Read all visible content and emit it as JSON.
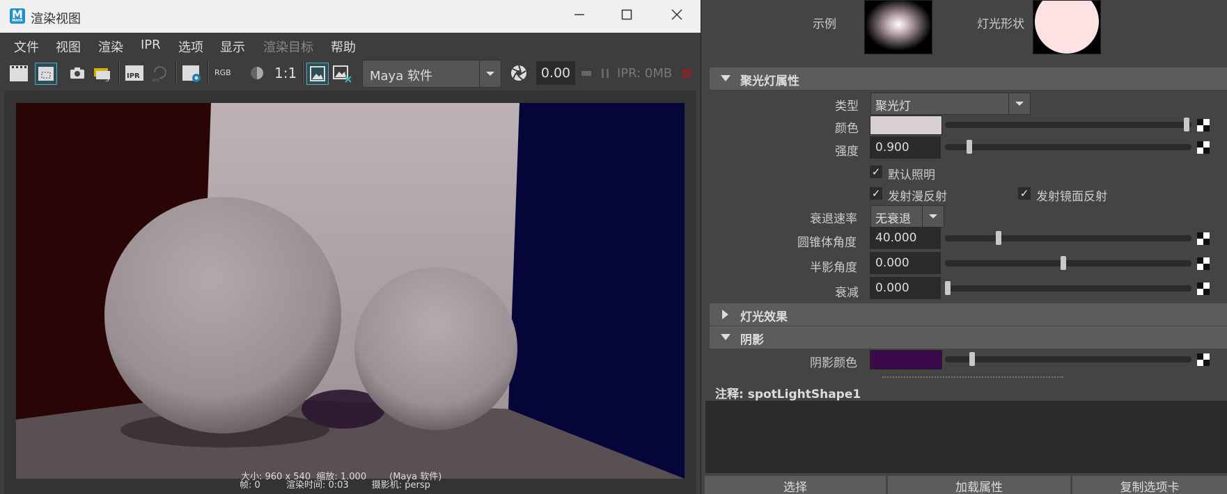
{
  "window": {
    "title": "渲染视图",
    "app_icon_letter": "M",
    "app_icon_sub": "MAYA"
  },
  "menu": [
    "文件",
    "视图",
    "渲染",
    "IPR",
    "选项",
    "显示",
    "渲染目标",
    "帮助"
  ],
  "menu_disabled_index": 6,
  "toolbar": {
    "ratio_label": "1:1",
    "rgb_label": "RGB",
    "ipr_label": "IPR",
    "renderer": "Maya 软件",
    "exposure": "0.00",
    "ipr_memory": "IPR: 0MB"
  },
  "render_info": {
    "line1": "大小: 960 x 540  缩放: 1.000        (Maya 软件)",
    "line2": "帧: 0         渲染时间: 0:03        摄影机: persp"
  },
  "attr": {
    "example_label": "示例",
    "light_shape_label": "灯光形状",
    "spotlight_section": "聚光灯属性",
    "type_label": "类型",
    "type_value": "聚光灯",
    "color_label": "颜色",
    "intensity_label": "强度",
    "intensity_value": "0.900",
    "default_lighting": "默认照明",
    "emit_diffuse": "发射漫反射",
    "emit_specular": "发射镜面反射",
    "decay_rate_label": "衰退速率",
    "decay_rate_value": "无衰退",
    "cone_angle_label": "圆锥体角度",
    "cone_angle_value": "40.000",
    "penumbra_label": "半影角度",
    "penumbra_value": "0.000",
    "dropoff_label": "衰减",
    "dropoff_value": "0.000",
    "light_effects_section": "灯光效果",
    "shadows_section": "阴影",
    "shadow_color_label": "阴影颜色",
    "notes_label": "注释:  spotLightShape1",
    "select_button": "选择",
    "load_attributes_button": "加载属性",
    "copy_tab_button": "复制选项卡"
  },
  "colors": {
    "light_color": "#d8cfd0",
    "shadow_color": "#3a0a4a",
    "render_floor": "#5a5054",
    "render_left_wall": "#2a0505",
    "render_back_wall": "#b9aeb1",
    "render_right_wall": "#05053a"
  },
  "sliders": {
    "color_level": 0.99,
    "intensity_level": 0.09,
    "cone_angle_level": 0.21,
    "penumbra_level": 0.48,
    "dropoff_level": 0.0,
    "shadow_color_level": 0.1
  }
}
